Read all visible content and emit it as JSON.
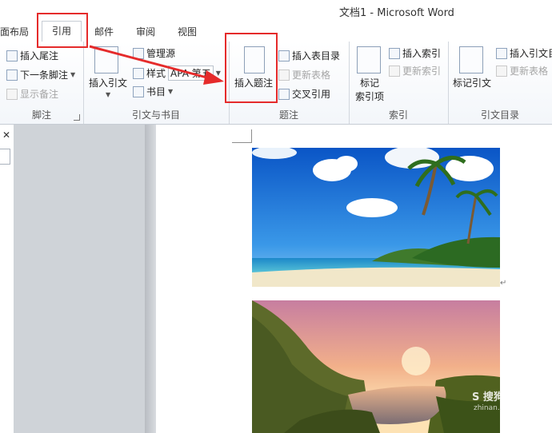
{
  "window": {
    "title": "文档1 - Microsoft Word"
  },
  "tabs": [
    "面布局",
    "引用",
    "邮件",
    "审阅",
    "视图"
  ],
  "ribbon": {
    "footnotes": {
      "label": "脚注",
      "insert_endnote": "插入尾注",
      "next_footnote": "下一条脚注",
      "show_notes": "显示备注"
    },
    "citations": {
      "label": "引文与书目",
      "insert_citation": "插入引文",
      "manage_sources": "管理源",
      "style_label": "样式",
      "style_value": "APA 第五",
      "bibliography": "书目"
    },
    "captions": {
      "label": "题注",
      "insert_caption": "插入题注",
      "insert_table_of_figures": "插入表目录",
      "update_table": "更新表格",
      "cross_reference": "交叉引用"
    },
    "index": {
      "label": "索引",
      "mark_entry": "标记\n索引项",
      "insert_index": "插入索引",
      "update_index": "更新索引"
    },
    "authorities": {
      "label": "引文目录",
      "mark_citation": "标记引文",
      "insert_authorities": "插入引文目",
      "update_table": "更新表格"
    }
  },
  "left_pane": {
    "close": "✕"
  },
  "document": {
    "paragraph_mark": "↵"
  },
  "watermark": {
    "text": "S 搜狗指南",
    "site": "zhinan.sogou.com"
  },
  "colors": {
    "highlight": "#e52b2b",
    "ribbon_border": "#c6ccd4"
  }
}
